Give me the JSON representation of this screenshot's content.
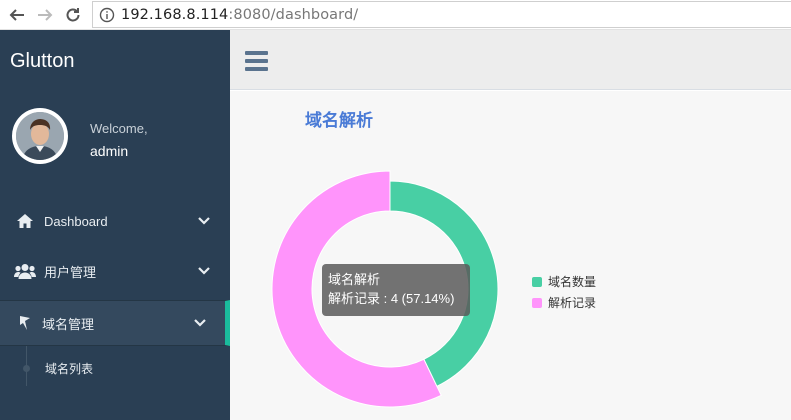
{
  "browser": {
    "url_host": "192.168.8.114",
    "url_rest": ":8080/dashboard/"
  },
  "sidebar": {
    "brand": "Glutton",
    "welcome": "Welcome,",
    "username": "admin",
    "items": [
      {
        "label": "Dashboard",
        "icon": "home-icon"
      },
      {
        "label": "用户管理",
        "icon": "users-icon"
      },
      {
        "label": "域名管理",
        "icon": "domain-icon"
      }
    ],
    "subitems": [
      {
        "label": "域名列表"
      }
    ]
  },
  "colors": {
    "sidebar_bg": "#2a3f54",
    "accent": "#1abb9c",
    "series_domain": "#48cfa4",
    "series_records": "#ff94fb",
    "title": "#4a7bd6"
  },
  "panel": {
    "title": "域名解析"
  },
  "tooltip": {
    "title": "域名解析",
    "body": "解析记录 : 4 (57.14%)"
  },
  "chart_data": {
    "type": "pie",
    "donut": true,
    "title": "域名解析",
    "series": [
      {
        "name": "域名数量",
        "value": 3,
        "percent": 42.86,
        "color": "#48cfa4"
      },
      {
        "name": "解析记录",
        "value": 4,
        "percent": 57.14,
        "color": "#ff94fb"
      }
    ],
    "legend_position": "right",
    "highlighted": "解析记录"
  }
}
